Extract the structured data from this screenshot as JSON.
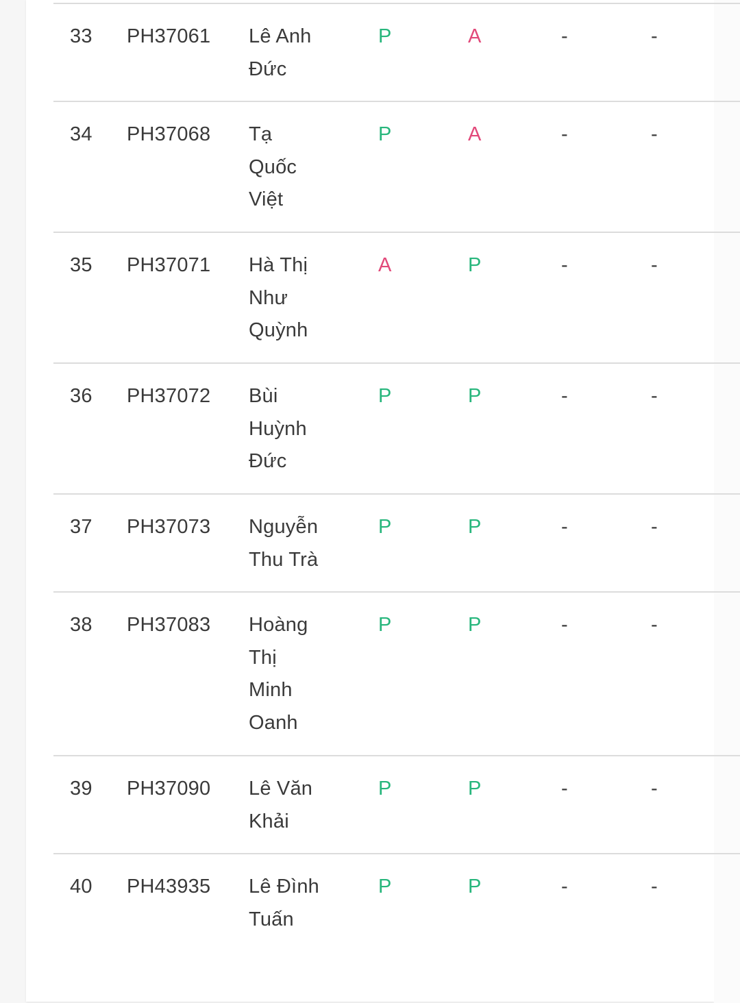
{
  "colors": {
    "present": "#27b67c",
    "absent": "#e2497a",
    "text": "#3a3a3a",
    "divider": "#dcdcdc"
  },
  "rows": [
    {
      "stt": "33",
      "code": "PH37061",
      "name_lines": [
        "Lê Anh",
        "Đức"
      ],
      "s1": "P",
      "s2": "A",
      "s3": "-",
      "s4": "-"
    },
    {
      "stt": "34",
      "code": "PH37068",
      "name_lines": [
        "Tạ",
        "Quốc",
        "Việt"
      ],
      "s1": "P",
      "s2": "A",
      "s3": "-",
      "s4": "-"
    },
    {
      "stt": "35",
      "code": "PH37071",
      "name_lines": [
        "Hà Thị",
        "Như",
        "Quỳnh"
      ],
      "s1": "A",
      "s2": "P",
      "s3": "-",
      "s4": "-"
    },
    {
      "stt": "36",
      "code": "PH37072",
      "name_lines": [
        "Bùi",
        "Huỳnh",
        "Đức"
      ],
      "s1": "P",
      "s2": "P",
      "s3": "-",
      "s4": "-"
    },
    {
      "stt": "37",
      "code": "PH37073",
      "name_lines": [
        "Nguyễn",
        "Thu Trà"
      ],
      "s1": "P",
      "s2": "P",
      "s3": "-",
      "s4": "-"
    },
    {
      "stt": "38",
      "code": "PH37083",
      "name_lines": [
        "Hoàng",
        "Thị",
        "Minh",
        "Oanh"
      ],
      "s1": "P",
      "s2": "P",
      "s3": "-",
      "s4": "-"
    },
    {
      "stt": "39",
      "code": "PH37090",
      "name_lines": [
        "Lê Văn",
        "Khải"
      ],
      "s1": "P",
      "s2": "P",
      "s3": "-",
      "s4": "-"
    },
    {
      "stt": "40",
      "code": "PH43935",
      "name_lines": [
        "Lê Đình",
        "Tuấn"
      ],
      "s1": "P",
      "s2": "P",
      "s3": "-",
      "s4": "-"
    }
  ]
}
